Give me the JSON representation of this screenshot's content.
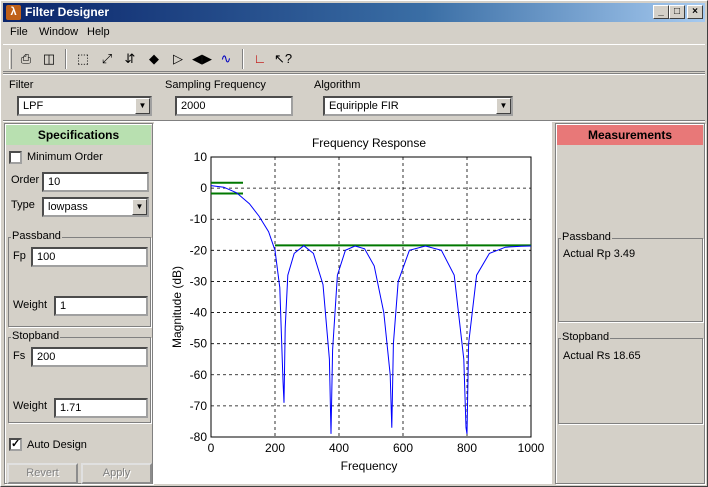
{
  "window": {
    "title": "Filter Designer"
  },
  "menu": [
    "File",
    "Window",
    "Help"
  ],
  "toolbar": {
    "buttons": [
      "printer-icon",
      "print-preview-icon",
      "select-region-icon",
      "zoom-fit-icon",
      "zoom-vertical-icon",
      "zoom-in-y-icon",
      "zoom-x-icon",
      "zoom-in-x-icon",
      "response-plot-icon",
      "filter-view-icon",
      "whats-this-icon"
    ]
  },
  "params": {
    "filter_label": "Filter",
    "filter_value": "LPF",
    "sampling_label": "Sampling Frequency",
    "sampling_value": "2000",
    "algorithm_label": "Algorithm",
    "algorithm_value": "Equiripple FIR"
  },
  "specs": {
    "title": "Specifications",
    "min_order_label": "Minimum Order",
    "min_order_checked": false,
    "order_label": "Order",
    "order_value": "10",
    "type_label": "Type",
    "type_value": "lowpass",
    "passband": {
      "title": "Passband",
      "fp_label": "Fp",
      "fp_value": "100",
      "weight_label": "Weight",
      "weight_value": "1"
    },
    "stopband": {
      "title": "Stopband",
      "fs_label": "Fs",
      "fs_value": "200",
      "weight_label": "Weight",
      "weight_value": "1.71"
    },
    "auto_design_label": "Auto Design",
    "auto_design_checked": true,
    "revert_label": "Revert",
    "apply_label": "Apply"
  },
  "measurements": {
    "title": "Measurements",
    "passband_title": "Passband",
    "rp_text": "Actual Rp  3.49",
    "stopband_title": "Stopband",
    "rs_text": "Actual Rs  18.65"
  },
  "colors": {
    "spec_header": "#b8e0b0",
    "meas_header": "#e87878",
    "curve": "#0000ff",
    "spec_lines": "#007800"
  },
  "chart_data": {
    "type": "line",
    "title": "Frequency Response",
    "xlabel": "Frequency",
    "ylabel": "Magnitude (dB)",
    "xlim": [
      0,
      1000
    ],
    "ylim": [
      -80,
      10
    ],
    "xticks": [
      0,
      200,
      400,
      600,
      800,
      1000
    ],
    "yticks": [
      10,
      0,
      -10,
      -20,
      -30,
      -40,
      -50,
      -60,
      -70,
      -80
    ],
    "grid": true,
    "series": [
      {
        "name": "",
        "x": [
          0,
          40,
          80,
          120,
          150,
          180,
          200,
          215,
          225,
          228,
          232,
          240,
          260,
          290,
          320,
          350,
          370,
          375,
          380,
          395,
          420,
          450,
          480,
          510,
          540,
          560,
          565,
          570,
          585,
          620,
          670,
          720,
          760,
          790,
          797,
          800,
          805,
          830,
          870,
          920,
          970,
          1000
        ],
        "y": [
          0.8,
          0.3,
          -1.5,
          -5,
          -9,
          -14,
          -20,
          -32,
          -62,
          -69,
          -45,
          -28,
          -21,
          -18.5,
          -21,
          -31,
          -55,
          -79,
          -52,
          -28,
          -20,
          -18.6,
          -19.5,
          -25,
          -40,
          -60,
          -77,
          -50,
          -30,
          -20,
          -18.6,
          -20,
          -28,
          -55,
          -77,
          -79,
          -50,
          -28,
          -21,
          -19,
          -18.7,
          -18.6
        ]
      }
    ],
    "spec_lines": [
      {
        "x": [
          0,
          100
        ],
        "y": [
          1.74,
          1.74
        ]
      },
      {
        "x": [
          0,
          100
        ],
        "y": [
          -1.74,
          -1.74
        ]
      },
      {
        "x": [
          200,
          1000
        ],
        "y": [
          -18.4,
          -18.4
        ]
      }
    ]
  }
}
